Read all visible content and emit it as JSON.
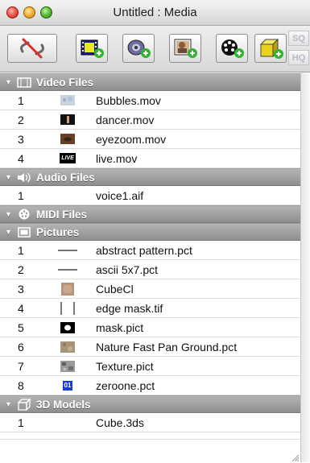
{
  "window": {
    "title": "Untitled : Media"
  },
  "toolbar": {
    "buttons": [
      {
        "name": "remove-link-button",
        "icon": "unlink-icon"
      },
      {
        "name": "add-video-button",
        "icon": "film-add-icon"
      },
      {
        "name": "add-audio-button",
        "icon": "speaker-add-icon"
      },
      {
        "name": "add-picture-button",
        "icon": "picture-add-icon"
      },
      {
        "name": "add-midi-button",
        "icon": "midi-add-icon"
      },
      {
        "name": "add-3d-button",
        "icon": "cube-add-icon"
      }
    ],
    "side_top": "SQ",
    "side_bottom": "HQ"
  },
  "sections": {
    "video": {
      "label": "Video Files",
      "items": [
        {
          "num": "1",
          "name": "Bubbles.mov"
        },
        {
          "num": "2",
          "name": "dancer.mov"
        },
        {
          "num": "3",
          "name": "eyezoom.mov"
        },
        {
          "num": "4",
          "name": "live.mov"
        }
      ]
    },
    "audio": {
      "label": "Audio Files",
      "items": [
        {
          "num": "1",
          "name": "voice1.aif"
        }
      ]
    },
    "midi": {
      "label": "MIDI Files"
    },
    "pictures": {
      "label": "Pictures",
      "items": [
        {
          "num": "1",
          "name": "abstract pattern.pct"
        },
        {
          "num": "2",
          "name": "ascii 5x7.pct"
        },
        {
          "num": "3",
          "name": "CubeCl"
        },
        {
          "num": "4",
          "name": "edge mask.tif"
        },
        {
          "num": "5",
          "name": "mask.pict"
        },
        {
          "num": "6",
          "name": "Nature Fast Pan Ground.pct"
        },
        {
          "num": "7",
          "name": "Texture.pict"
        },
        {
          "num": "8",
          "name": "zeroone.pct"
        }
      ]
    },
    "models": {
      "label": "3D Models",
      "items": [
        {
          "num": "1",
          "name": "Cube.3ds"
        }
      ]
    }
  },
  "thumbnails": {
    "live_badge": "LIVE",
    "zeroone_badge": "01"
  },
  "colors": {
    "header_bg": "#9e9e9e",
    "plus_green": "#33b233",
    "cube_yellow": "#e8d21e",
    "unlink_red": "#d8302a"
  }
}
